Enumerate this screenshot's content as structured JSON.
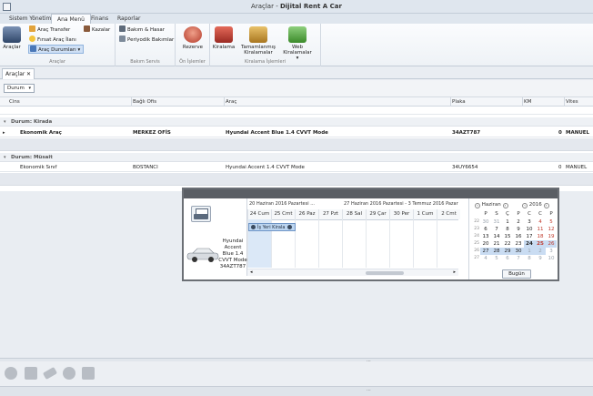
{
  "window": {
    "title_prefix": "Araçlar - ",
    "title_app": "Dijital Rent A Car"
  },
  "ribbon": {
    "tabs": [
      "Sistem Yönetimi",
      "Ana Menü",
      "Finans",
      "Raporlar"
    ],
    "groups": {
      "araclar": {
        "label": "Araçlar",
        "big_button": "Araçlar",
        "items": [
          "Araç Transfer",
          "Fırsat Araç İlanı",
          "Araç Durumları"
        ],
        "extra_item": "Kazalar"
      },
      "bakim": {
        "label": "Bakım Servis",
        "items": [
          "Bakım & Hasar",
          "Periyodik Bakımlar"
        ]
      },
      "on_islemler": {
        "label": "Ön İşlemler",
        "button": "Rezerve"
      },
      "kiralama": {
        "label": "Kiralama İşlemleri",
        "buttons": [
          "Kiralama",
          "Tamamlanmış Kiralamalar",
          "Web Kiralamalar"
        ]
      }
    }
  },
  "doc_tab": {
    "label": "Araçlar",
    "close": "✕"
  },
  "group_panel": {
    "chip": "Durum"
  },
  "grid": {
    "columns": [
      "Cins",
      "Bağlı Ofis",
      "Araç",
      "Plaka",
      "KM",
      "Vites"
    ],
    "groups": [
      {
        "title": "Durum: Kirada",
        "rows": [
          {
            "cins": "Ekonomik Araç",
            "ofis": "MERKEZ OFİS",
            "arac": "Hyundai Accent Blue 1.4 CVVT Mode",
            "plaka": "34AZT787",
            "km": "0",
            "vites": "MANUEL"
          }
        ]
      },
      {
        "title": "Durum: Müsait",
        "rows": [
          {
            "cins": "Ekonomik Sınıf",
            "ofis": "BOSTANCI",
            "arac": "Hyundai Accent 1.4 CVVT Mode",
            "plaka": "34UY6654",
            "km": "0",
            "vites": "MANUEL"
          }
        ]
      }
    ]
  },
  "scheduler": {
    "resource_label": "Hyundai Accent Blue 1.4 CVVT Mode 34AZT787",
    "week1": "20 Haziran 2016 Pazartesi ...",
    "week2": "27 Haziran 2016 Pazartesi - 3 Temmuz 2016 Pazar",
    "days": [
      "24 Cum",
      "25 Cmt",
      "26 Paz",
      "27 Pzt",
      "28 Sal",
      "29 Çar",
      "30 Per",
      "1 Cum",
      "2 Cmt"
    ],
    "appointment": "İş Yeri Kirala",
    "calendar": {
      "month": "Haziran",
      "year": "2016",
      "weekdays": [
        "P",
        "S",
        "Ç",
        "P",
        "C",
        "C",
        "P"
      ],
      "week_numbers": [
        "22",
        "23",
        "24",
        "25",
        "26",
        "27"
      ],
      "weeks": [
        [
          "30",
          "31",
          "1",
          "2",
          "3",
          "4",
          "5"
        ],
        [
          "6",
          "7",
          "8",
          "9",
          "10",
          "11",
          "12"
        ],
        [
          "13",
          "14",
          "15",
          "16",
          "17",
          "18",
          "19"
        ],
        [
          "20",
          "21",
          "22",
          "23",
          "24",
          "25",
          "26"
        ],
        [
          "27",
          "28",
          "29",
          "30",
          "1",
          "2",
          "3"
        ],
        [
          "4",
          "5",
          "6",
          "7",
          "8",
          "9",
          "10"
        ]
      ],
      "today_button": "Bugün"
    }
  },
  "icons": {
    "colors": {
      "accent": "#5a5e64",
      "selection": "#bcd5f0",
      "weekend": "#c0392b"
    }
  }
}
